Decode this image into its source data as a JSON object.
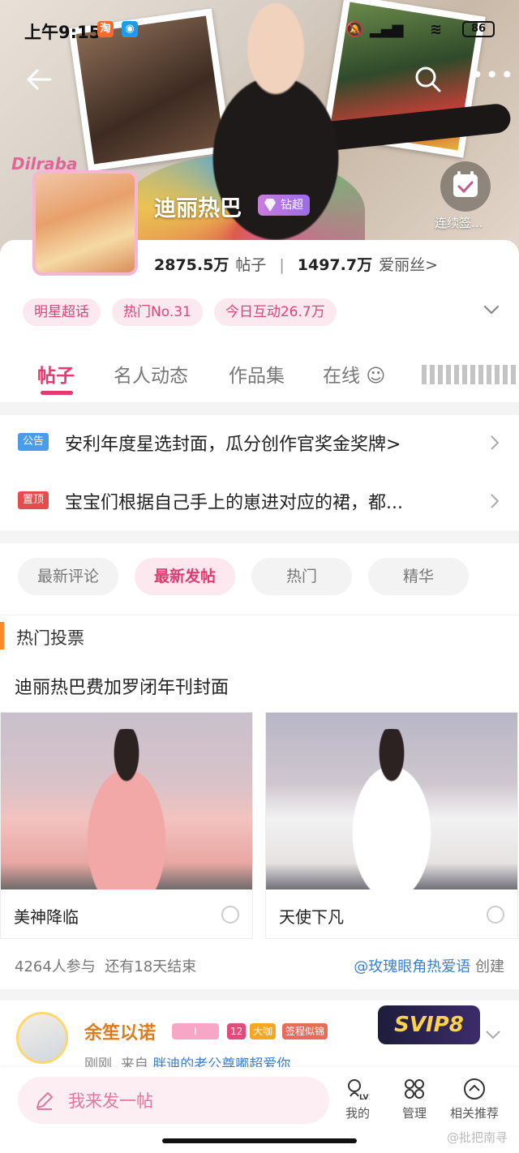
{
  "status_bar": {
    "time": "上午9:15",
    "battery": "86"
  },
  "hero": {
    "title": "迪丽热巴",
    "badge": "钻超",
    "avatar_tag": "Dilraba",
    "signin_label": "连续签..."
  },
  "stats": {
    "posts_value": "2875.5万",
    "posts_label": "帖子",
    "fans_value": "1497.7万",
    "fans_label": "爱丽丝>"
  },
  "chips": [
    "明星超话",
    "热门No.31",
    "今日互动26.7万"
  ],
  "tabs": [
    {
      "label": "帖子",
      "active": true
    },
    {
      "label": "名人动态",
      "active": false
    },
    {
      "label": "作品集",
      "active": false
    },
    {
      "label": "在线",
      "active": false
    }
  ],
  "notices": [
    {
      "tag": "公告",
      "tag_color": "#4a9be8",
      "text": "安利年度星选封面，瓜分创作官奖金奖牌>"
    },
    {
      "tag": "置顶",
      "tag_color": "#e84b4b",
      "text": "宝宝们根据自己手上的崽进对应的裙，都..."
    }
  ],
  "filters": [
    {
      "label": "最新评论",
      "active": false
    },
    {
      "label": "最新发帖",
      "active": true
    },
    {
      "label": "热门",
      "active": false
    },
    {
      "label": "精华",
      "active": false
    }
  ],
  "section": {
    "label": "热门投票"
  },
  "vote": {
    "title": "迪丽热巴费加罗闭年刊封面",
    "options": [
      {
        "label": "美神降临",
        "dress": "pink-gown"
      },
      {
        "label": "天使下凡",
        "dress": "white-ruffle"
      }
    ],
    "participants": "4264人参与",
    "remaining": "还有18天结束",
    "creator": "@玫瑰眼角热爱语",
    "creator_suffix": "创建"
  },
  "post": {
    "name": "余笙以诺",
    "badges": [
      "I",
      "12",
      "大咖",
      "签程似锦"
    ],
    "vip": "SVIP8",
    "time": "刚刚",
    "source_prefix": "来自",
    "source": "胖迪的老公尊嘟超爱你"
  },
  "bottom": {
    "compose": "我来发一帖",
    "nav": [
      {
        "label": "我的",
        "icon": "level-icon"
      },
      {
        "label": "管理",
        "icon": "grid-icon"
      },
      {
        "label": "相关推荐",
        "icon": "compass-icon"
      }
    ]
  },
  "watermark": "@批把南寻",
  "colors": {
    "accent": "#e23b6f",
    "chip_bg": "#fce9ef",
    "link": "#3c7fcf"
  }
}
